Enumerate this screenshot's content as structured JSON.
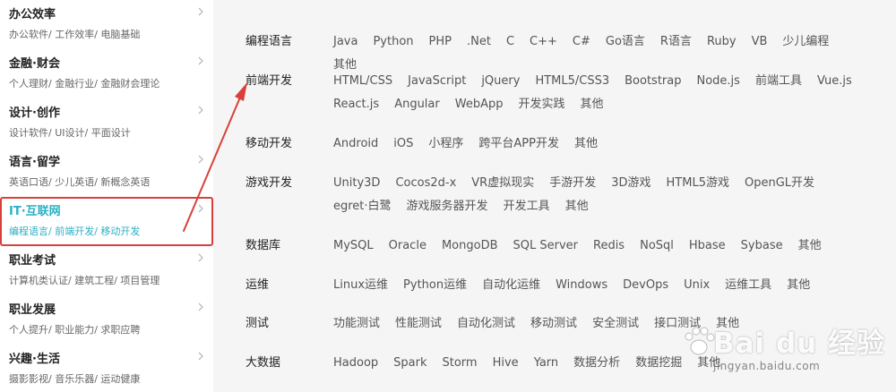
{
  "sidebar": {
    "categories": [
      {
        "title": "办公效率",
        "subs": "办公软件/ 工作效率/ 电脑基础"
      },
      {
        "title": "金融·财会",
        "subs": "个人理财/ 金融行业/ 金融财会理论"
      },
      {
        "title": "设计·创作",
        "subs": "设计软件/ UI设计/ 平面设计"
      },
      {
        "title": "语言·留学",
        "subs": "英语口语/ 少儿英语/ 新概念英语"
      },
      {
        "title": "IT·互联网",
        "subs": "编程语言/ 前端开发/ 移动开发"
      },
      {
        "title": "职业考试",
        "subs": "计算机类认证/ 建筑工程/ 项目管理"
      },
      {
        "title": "职业发展",
        "subs": "个人提升/ 职业能力/ 求职应聘"
      },
      {
        "title": "兴趣·生活",
        "subs": "摄影影视/ 音乐乐器/ 运动健康"
      }
    ]
  },
  "panel": {
    "rows": [
      {
        "label": "编程语言",
        "items": [
          "Java",
          "Python",
          "PHP",
          ".Net",
          "C",
          "C++",
          "C#",
          "Go语言",
          "R语言",
          "Ruby",
          "VB",
          "少儿编程",
          "其他"
        ]
      },
      {
        "label": "前端开发",
        "items": [
          "HTML/CSS",
          "JavaScript",
          "jQuery",
          "HTML5/CSS3",
          "Bootstrap",
          "Node.js",
          "前端工具",
          "Vue.js",
          "React.js",
          "Angular",
          "WebApp",
          "开发实践",
          "其他"
        ]
      },
      {
        "label": "移动开发",
        "items": [
          "Android",
          "iOS",
          "小程序",
          "跨平台APP开发",
          "其他"
        ]
      },
      {
        "label": "游戏开发",
        "items": [
          "Unity3D",
          "Cocos2d-x",
          "VR虚拟现实",
          "手游开发",
          "3D游戏",
          "HTML5游戏",
          "OpenGL开发",
          "egret·白鹭",
          "游戏服务器开发",
          "开发工具",
          "其他"
        ]
      },
      {
        "label": "数据库",
        "items": [
          "MySQL",
          "Oracle",
          "MongoDB",
          "SQL Server",
          "Redis",
          "NoSql",
          "Hbase",
          "Sybase",
          "其他"
        ]
      },
      {
        "label": "运维",
        "items": [
          "Linux运维",
          "Python运维",
          "自动化运维",
          "Windows",
          "DevOps",
          "Unix",
          "运维工具",
          "其他"
        ]
      },
      {
        "label": "测试",
        "items": [
          "功能测试",
          "性能测试",
          "自动化测试",
          "移动测试",
          "安全测试",
          "接口测试",
          "其他"
        ]
      },
      {
        "label": "大数据",
        "items": [
          "Hadoop",
          "Spark",
          "Storm",
          "Hive",
          "Yarn",
          "数据分析",
          "数据挖掘",
          "其他"
        ]
      }
    ]
  },
  "watermark": {
    "main": "Bai du 经验",
    "sub": "jingyan.baidu.com"
  },
  "colors": {
    "accent": "#2bb0c5",
    "highlight_border": "#d9403a",
    "arrow": "#d9403a"
  }
}
